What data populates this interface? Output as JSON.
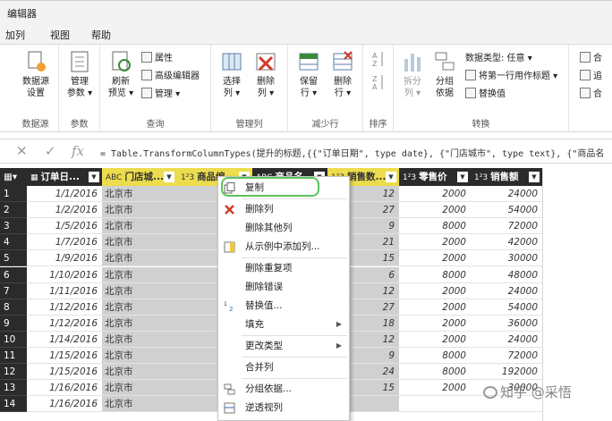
{
  "window": {
    "title": "编辑器"
  },
  "menu": [
    "加列",
    "视图",
    "帮助"
  ],
  "ribbon": {
    "groups": [
      {
        "label": "数据源",
        "buttons": [
          {
            "label": "数据源\n设置"
          }
        ]
      },
      {
        "label": "参数",
        "buttons": [
          {
            "label": "管理\n参数 ▾"
          }
        ]
      },
      {
        "label": "查询",
        "buttons": [
          {
            "label": "刷新\n预览 ▾"
          }
        ],
        "small": [
          "属性",
          "高级编辑器",
          "管理 ▾"
        ]
      },
      {
        "label": "管理列",
        "buttons": [
          {
            "label": "选择\n列 ▾"
          },
          {
            "label": "删除\n列 ▾"
          }
        ]
      },
      {
        "label": "减少行",
        "buttons": [
          {
            "label": "保留\n行 ▾"
          },
          {
            "label": "删除\n行 ▾"
          }
        ]
      },
      {
        "label": "排序",
        "buttons": []
      },
      {
        "label": "转换",
        "buttons": [
          {
            "label": "拆分\n列 ▾"
          },
          {
            "label": "分组\n依据"
          }
        ],
        "small": [
          "数据类型: 任意 ▾",
          "将第一行用作标题 ▾",
          "替换值"
        ]
      }
    ],
    "right_small": [
      "合",
      "追",
      "合"
    ]
  },
  "formula_bar": {
    "text": "= Table.TransformColumnTypes(提升的标题,{{\"订单日期\", type date}, {\"门店城市\", type text}, {\"商品名"
  },
  "table": {
    "columns": [
      {
        "name": "订单日...",
        "type": "date-icon"
      },
      {
        "name": "门店城...",
        "type": "text-icon"
      },
      {
        "name": "商品编...",
        "type": "number-icon"
      },
      {
        "name": "商品名...",
        "type": "text-icon"
      },
      {
        "name": "销售数...",
        "type": "number-icon"
      },
      {
        "name": "零售价",
        "type": "number-icon"
      },
      {
        "name": "销售额",
        "type": "number-icon"
      }
    ],
    "rows": [
      {
        "n": "1",
        "date": "1/1/2016",
        "city": "北京市",
        "qty": "12",
        "price": "2000",
        "amount": "24000"
      },
      {
        "n": "2",
        "date": "1/2/2016",
        "city": "北京市",
        "qty": "27",
        "price": "2000",
        "amount": "54000"
      },
      {
        "n": "3",
        "date": "1/5/2016",
        "city": "北京市",
        "qty": "9",
        "price": "8000",
        "amount": "72000"
      },
      {
        "n": "4",
        "date": "1/7/2016",
        "city": "北京市",
        "qty": "21",
        "price": "2000",
        "amount": "42000"
      },
      {
        "n": "5",
        "date": "1/9/2016",
        "city": "北京市",
        "qty": "15",
        "price": "2000",
        "amount": "30000"
      },
      {
        "n": "6",
        "date": "1/10/2016",
        "city": "北京市",
        "qty": "6",
        "price": "8000",
        "amount": "48000"
      },
      {
        "n": "7",
        "date": "1/11/2016",
        "city": "北京市",
        "qty": "12",
        "price": "2000",
        "amount": "24000"
      },
      {
        "n": "8",
        "date": "1/12/2016",
        "city": "北京市",
        "qty": "27",
        "price": "2000",
        "amount": "54000"
      },
      {
        "n": "9",
        "date": "1/12/2016",
        "city": "北京市",
        "qty": "18",
        "price": "2000",
        "amount": "36000"
      },
      {
        "n": "10",
        "date": "1/14/2016",
        "city": "北京市",
        "qty": "12",
        "price": "2000",
        "amount": "24000"
      },
      {
        "n": "11",
        "date": "1/15/2016",
        "city": "北京市",
        "qty": "9",
        "price": "8000",
        "amount": "72000"
      },
      {
        "n": "12",
        "date": "1/15/2016",
        "city": "北京市",
        "qty": "24",
        "price": "8000",
        "amount": "192000"
      },
      {
        "n": "13",
        "date": "1/16/2016",
        "city": "北京市",
        "qty": "15",
        "price": "2000",
        "amount": "30000"
      },
      {
        "n": "14",
        "date": "1/16/2016",
        "city": "北京市",
        "qty": "",
        "price": "",
        "amount": ""
      }
    ]
  },
  "context_menu": [
    {
      "label": "复制",
      "icon": "copy-icon"
    },
    {
      "sep": true
    },
    {
      "label": "删除列",
      "icon": "delete-icon"
    },
    {
      "label": "删除其他列",
      "icon": ""
    },
    {
      "label": "从示例中添加列...",
      "icon": "example-icon"
    },
    {
      "sep": true
    },
    {
      "label": "删除重复项",
      "icon": ""
    },
    {
      "label": "删除错误",
      "icon": ""
    },
    {
      "label": "替换值...",
      "icon": "replace-icon"
    },
    {
      "label": "填充",
      "icon": "",
      "submenu": true
    },
    {
      "sep": true
    },
    {
      "label": "更改类型",
      "icon": "",
      "submenu": true
    },
    {
      "sep": true
    },
    {
      "label": "合并列",
      "icon": ""
    },
    {
      "sep": true
    },
    {
      "label": "分组依据...",
      "icon": "group-icon"
    },
    {
      "label": "逆透视列",
      "icon": "unpivot-icon"
    }
  ],
  "watermark": "知乎 @采悟",
  "colors": {
    "header_bg": "#2b2b2b",
    "selected_header": "#ecdc4e",
    "selected_column": "#d0d0d0",
    "highlight_ring": "#5ac35a"
  }
}
